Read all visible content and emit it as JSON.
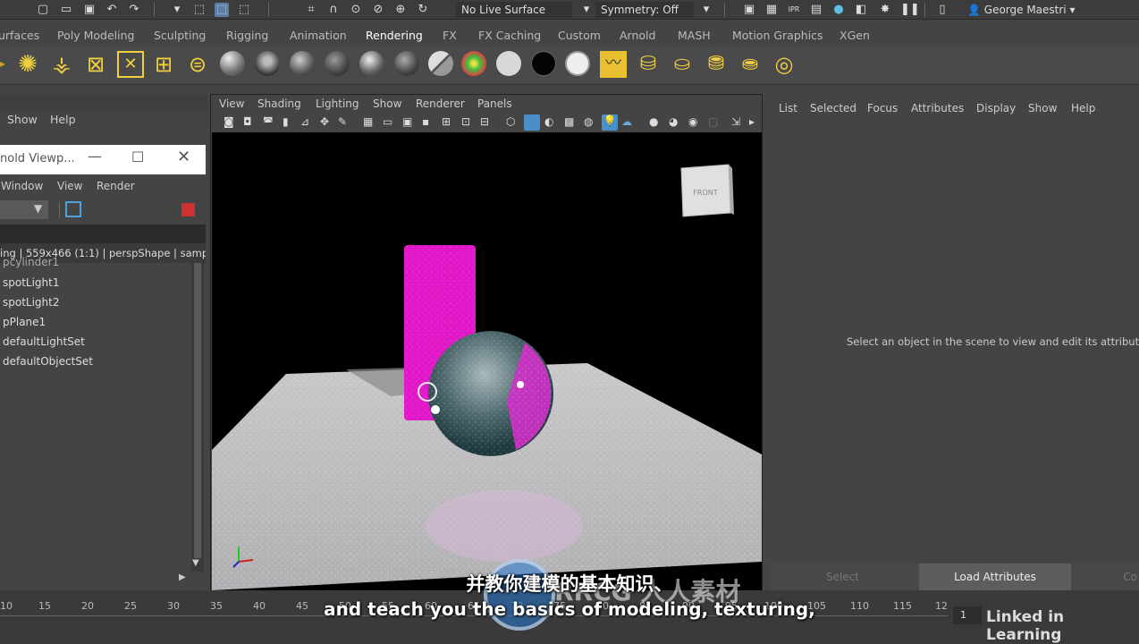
{
  "topbar": {
    "live_surface": "No Live Surface",
    "symmetry": "Symmetry: Off",
    "user": "George Maestri"
  },
  "shelf_tabs": [
    "urfaces",
    "Poly Modeling",
    "Sculpting",
    "Rigging",
    "Animation",
    "Rendering",
    "FX",
    "FX Caching",
    "Custom",
    "Arnold",
    "MASH",
    "Motion Graphics",
    "XGen"
  ],
  "shelf_active": "Rendering",
  "left_menu": {
    "show": "Show",
    "help": "Help"
  },
  "arnold_viewer": {
    "title": "nold Viewp...",
    "menu": [
      "Window",
      "View",
      "Render"
    ],
    "status": "ing | 559x466 (1:1) | perspShape | samp"
  },
  "outliner": {
    "items": [
      "pcylinder1",
      "spotLight1",
      "spotLight2",
      "pPlane1",
      "defaultLightSet",
      "defaultObjectSet"
    ]
  },
  "viewport": {
    "menu": [
      "View",
      "Shading",
      "Lighting",
      "Show",
      "Renderer",
      "Panels"
    ],
    "cube_label": "FRONT"
  },
  "attribute_editor": {
    "menu": [
      "List",
      "Selected",
      "Focus",
      "Attributes",
      "Display",
      "Show",
      "Help"
    ],
    "message": "Select an object in the scene to view and edit its attribute",
    "buttons": {
      "select": "Select",
      "load": "Load Attributes",
      "copy": "Co"
    }
  },
  "timeline": {
    "ticks": [
      "10",
      "15",
      "20",
      "25",
      "30",
      "35",
      "40",
      "45",
      "50",
      "55",
      "60",
      "65",
      "70",
      "75",
      "80",
      "85",
      "90",
      "95",
      "100",
      "105",
      "110",
      "115",
      "12"
    ],
    "current_frame": "1",
    "watermark": "Linked in Learning"
  },
  "subtitles": {
    "zh": "并教你建模的基本知识、",
    "en": "and teach you the basics of modeling, texturing,"
  },
  "overlay_watermark": "RRCG 人人素材"
}
